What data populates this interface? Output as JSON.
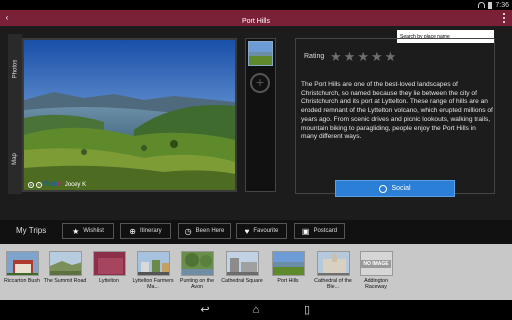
{
  "status_bar": {
    "time": "7:36"
  },
  "header": {
    "title": "Port Hills"
  },
  "search": {
    "placeholder": "Search by place name"
  },
  "side_tabs": {
    "photos": "Photos",
    "map": "Map"
  },
  "photo": {
    "source": "flickr",
    "author": "Jocey K"
  },
  "rating": {
    "label": "Rating",
    "stars": 5,
    "value": 0
  },
  "description": "The Port Hills are one of the best-loved landscapes of Christchurch, so named because they lie between the city of Christchurch and its port at Lyttelton. These range of hills are an eroded remnant of the Lyttelton volcano, which erupted millions of years ago. From scenic drives and picnic lookouts, walking trails, mountain biking to paragliding, people enjoy the Port Hills in many different ways.",
  "social_button": {
    "label": "Social"
  },
  "trips": {
    "label": "My Trips",
    "buttons": [
      {
        "label": "Wishlist",
        "icon": "star-icon"
      },
      {
        "label": "Itinerary",
        "icon": "plus-circle-icon"
      },
      {
        "label": "Been Here",
        "icon": "clock-icon"
      },
      {
        "label": "Favourite",
        "icon": "heart-icon"
      },
      {
        "label": "Postcard",
        "icon": "postcard-icon"
      }
    ]
  },
  "gallery": [
    {
      "label": "Riccarton Bush"
    },
    {
      "label": "The Summit Road"
    },
    {
      "label": "Lyttelton"
    },
    {
      "label": "Lyttelton Farmers Ma..."
    },
    {
      "label": "Punting on the Avon"
    },
    {
      "label": "Cathedral Square"
    },
    {
      "label": "Port Hills"
    },
    {
      "label": "Cathedral of the Ble..."
    },
    {
      "label": "Addington Raceway",
      "image_text": "NO IMAGE"
    }
  ],
  "colors": {
    "title_bar": "#7a2137",
    "accent": "#2b7fd6"
  }
}
